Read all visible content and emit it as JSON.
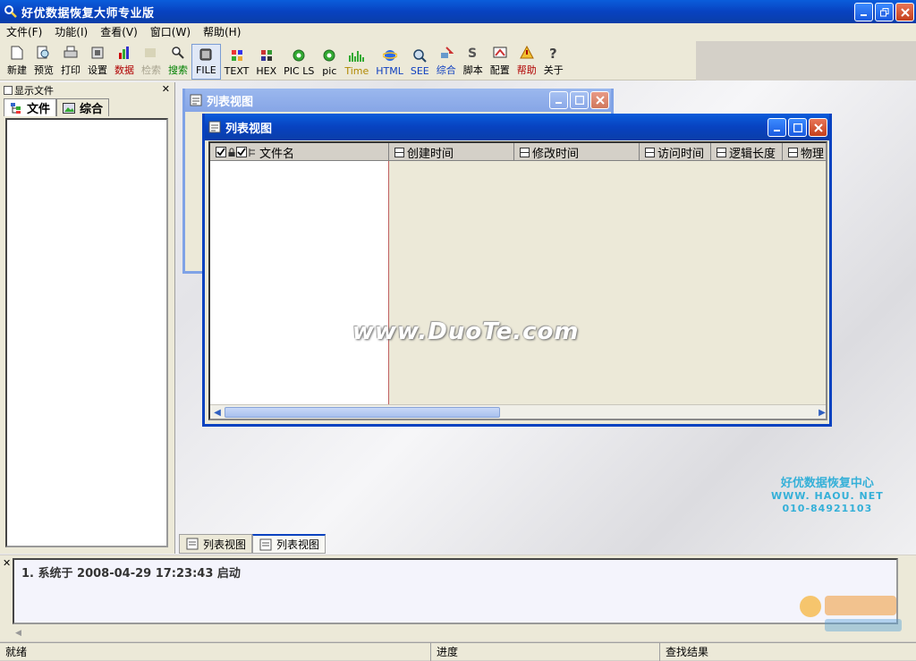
{
  "app": {
    "title": "好优数据恢复大师专业版"
  },
  "menu": [
    "文件(F)",
    "功能(I)",
    "查看(V)",
    "窗口(W)",
    "帮助(H)"
  ],
  "toolbar": [
    {
      "label": "新建",
      "icon": "new-file-icon"
    },
    {
      "label": "预览",
      "icon": "preview-icon"
    },
    {
      "label": "打印",
      "icon": "print-icon"
    },
    {
      "label": "设置",
      "icon": "settings-icon"
    },
    {
      "label": "数据",
      "icon": "data-icon"
    },
    {
      "label": "检索",
      "icon": "search-icon",
      "disabled": true
    },
    {
      "label": "搜索",
      "icon": "search-icon"
    },
    {
      "label": "FILE",
      "icon": "file-icon",
      "selected": true
    },
    {
      "label": "TEXT",
      "icon": "text-icon"
    },
    {
      "label": "HEX",
      "icon": "hex-icon"
    },
    {
      "label": "PIC LS",
      "icon": "picture-icon"
    },
    {
      "label": "pic",
      "icon": "picture-icon"
    },
    {
      "label": "Time",
      "icon": "time-icon"
    },
    {
      "label": "HTML",
      "icon": "html-icon"
    },
    {
      "label": "SEE",
      "icon": "see-icon"
    },
    {
      "label": "综合",
      "icon": "combine-icon"
    },
    {
      "label": "脚本",
      "icon": "script-icon"
    },
    {
      "label": "配置",
      "icon": "config-icon"
    },
    {
      "label": "帮助",
      "icon": "help-icon"
    },
    {
      "label": "关于",
      "icon": "about-icon"
    }
  ],
  "left_panel": {
    "title": "显示文件",
    "tabs": [
      "文件",
      "综合"
    ]
  },
  "window_back": {
    "title": "列表视图"
  },
  "window_front": {
    "title": "列表视图",
    "columns": [
      "文件名",
      "创建时间",
      "修改时间",
      "访问时间",
      "逻辑长度",
      "物理"
    ]
  },
  "watermark": "www.DuoTe.com",
  "brand": {
    "name": "好优数据恢复中心",
    "url": "WWW. HAOU. NET",
    "phone": "010-84921103"
  },
  "mdi_tabs": [
    "列表视图",
    "列表视图"
  ],
  "log": [
    "1. 系统于 2008-04-29 17:23:43 启动"
  ],
  "statusbar": [
    "就绪",
    "进度",
    "查找结果"
  ]
}
